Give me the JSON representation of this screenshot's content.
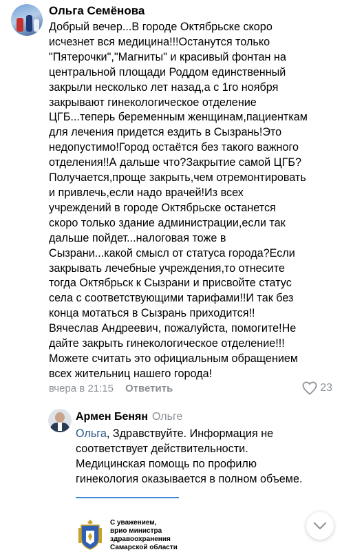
{
  "comment": {
    "author": "Ольга Семёнова",
    "text": "Добрый вечер...В городе Октябрьске скоро\nисчезнет вся медицина!!!Останутся только\n\"Пятерочки\",\"Магниты\" и красивый фонтан на\nцентральной площади Роддом единственный\nзакрыли несколько лет назад,а с 1го ноября\nзакрывают гинекологическое отделение\nЦГБ...теперь беременным женщинам,пациенткам\nдля лечения придется ездить в Сызрань!Это\nнедопустимо!Город остаётся без такого важного\nотделения!!А дальше что?Закрытие самой ЦГБ?\nПолучается,проще закрыть,чем отремонтировать\nи привлечь,если надо врачей!Из всех\nучреждений в городе Октябрьске останется\nскоро только здание администрации,если так\nдальше пойдет...налоговая тоже в\nСызрани...какой смысл от статуса города?Если\nзакрывать лечебные учреждения,то отнесите\nтогда Октябрьск к Сызрани и присвойте статус\nсела с соответствующими тарифами!!И так без\nконца мотаться в Сызрань приходится!!\nВячеслав Андреевич, пожалуйста, помогите!Не\nдайте закрыть гинекологическое отделение!!!\nМожете считать это официальным обращением\nвсех жительниц нашего города!",
    "time": "вчера в 21:15",
    "reply_label": "Ответить",
    "likes": "23"
  },
  "reply": {
    "author": "Армен Бенян",
    "to": "Ольге",
    "mention": "Ольга",
    "text": ", Здравствуйте. Информация не\nсоответствует действительности.\nМедицинская помощь по профилю\nгинекология оказывается в полном объеме.",
    "signature": "С уважением,\nврио министра\nздравоохранения\nСамарской области"
  },
  "colors": {
    "link": "#2a5885",
    "secondary": "#8a8f96",
    "divider": "#3f8ae0"
  }
}
